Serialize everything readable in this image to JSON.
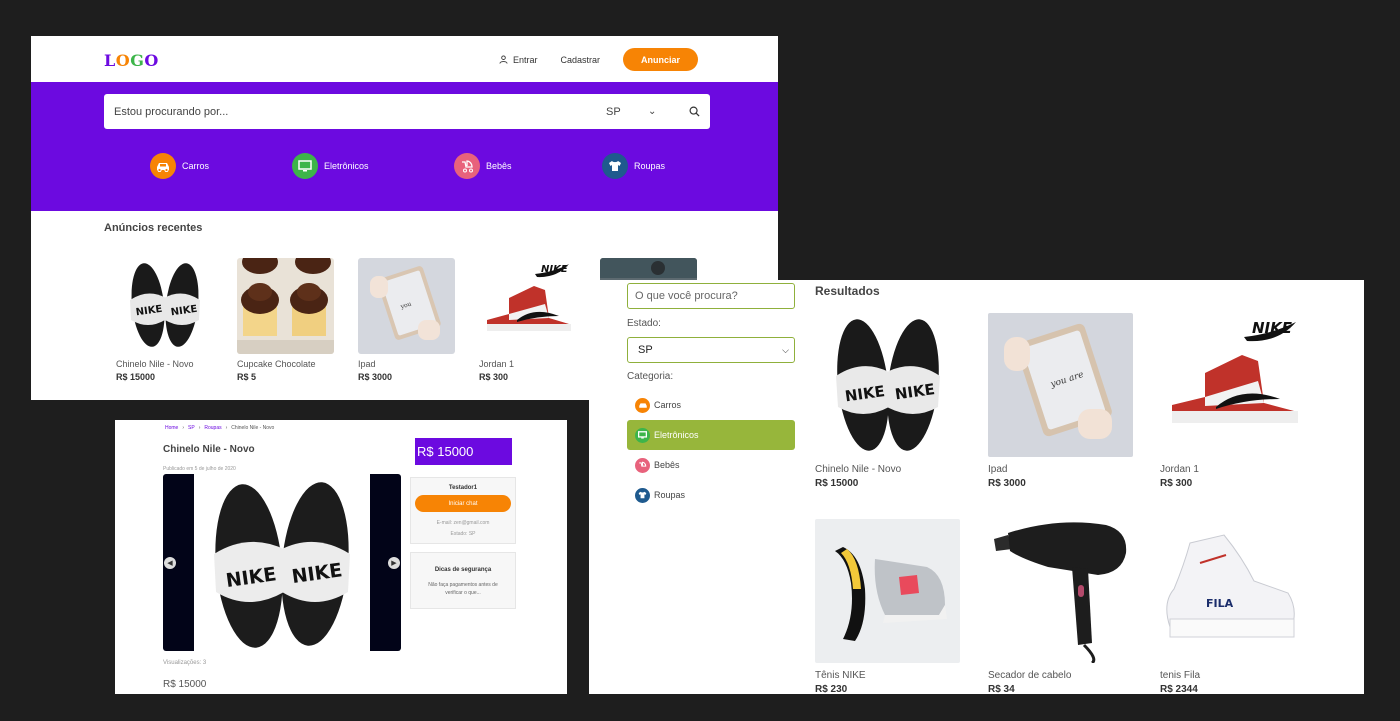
{
  "home": {
    "logo_letters": [
      "L",
      "O",
      "G",
      "O"
    ],
    "logo_colors": [
      "#6c0ae0",
      "#f78405",
      "#3db54a",
      "#6c0ae0"
    ],
    "nav": {
      "entrar": "Entrar",
      "cadastrar": "Cadastrar",
      "anunciar": "Anunciar"
    },
    "search": {
      "placeholder": "Estou procurando por...",
      "state": "SP"
    },
    "categories": [
      {
        "label": "Carros",
        "icon": "car-icon",
        "color": "#f78405"
      },
      {
        "label": "Eletrônicos",
        "icon": "monitor-icon",
        "color": "#3db54a"
      },
      {
        "label": "Bebês",
        "icon": "stroller-icon",
        "color": "#e8627c"
      },
      {
        "label": "Roupas",
        "icon": "shirt-icon",
        "color": "#1f5a8e"
      }
    ],
    "section_title": "Anúncios recentes",
    "recent": [
      {
        "title": "Chinelo Nile - Novo",
        "price": "R$ 15000"
      },
      {
        "title": "Cupcake Chocolate",
        "price": "R$ 5"
      },
      {
        "title": "Ipad",
        "price": "R$ 3000"
      },
      {
        "title": "Jordan 1",
        "price": "R$ 300"
      }
    ]
  },
  "product": {
    "breadcrumb": [
      "Home",
      "SP",
      "Roupas",
      "Chinelo Nile - Novo"
    ],
    "title": "Chinelo Nile - Novo",
    "published": "Publicado em 5 de julho de 2020",
    "price": "R$ 15000",
    "seller": {
      "name": "Testador1",
      "chat": "Iniciar chat",
      "email": "E-mail: zen@gmail.com",
      "state": "Estado: SP"
    },
    "tips": {
      "title": "Dicas de segurança",
      "body": "Não faça pagamentos antes de verificar o que..."
    },
    "views": "Visualizações: 3",
    "bottom_price": "R$ 15000"
  },
  "results": {
    "query_placeholder": "O que você procura?",
    "state_label": "Estado:",
    "state_value": "SP",
    "category_label": "Categoria:",
    "categories": [
      {
        "label": "Carros",
        "icon": "car-icon",
        "color": "#f78405"
      },
      {
        "label": "Eletrônicos",
        "icon": "monitor-icon",
        "color": "#3db54a"
      },
      {
        "label": "Bebês",
        "icon": "stroller-icon",
        "color": "#e8627c"
      },
      {
        "label": "Roupas",
        "icon": "shirt-icon",
        "color": "#1f5a8e"
      }
    ],
    "title": "Resultados",
    "items": [
      {
        "title": "Chinelo Nile - Novo",
        "price": "R$ 15000"
      },
      {
        "title": "Ipad",
        "price": "R$ 3000"
      },
      {
        "title": "Jordan 1",
        "price": "R$ 300"
      },
      {
        "title": "Tênis NIKE",
        "price": "R$ 230"
      },
      {
        "title": "Secador de cabelo",
        "price": "R$ 34"
      },
      {
        "title": "tenis Fila",
        "price": "R$ 2344"
      }
    ]
  },
  "colors": {
    "purple": "#6c0ae0",
    "orange": "#f78405",
    "green": "#97b63b"
  }
}
